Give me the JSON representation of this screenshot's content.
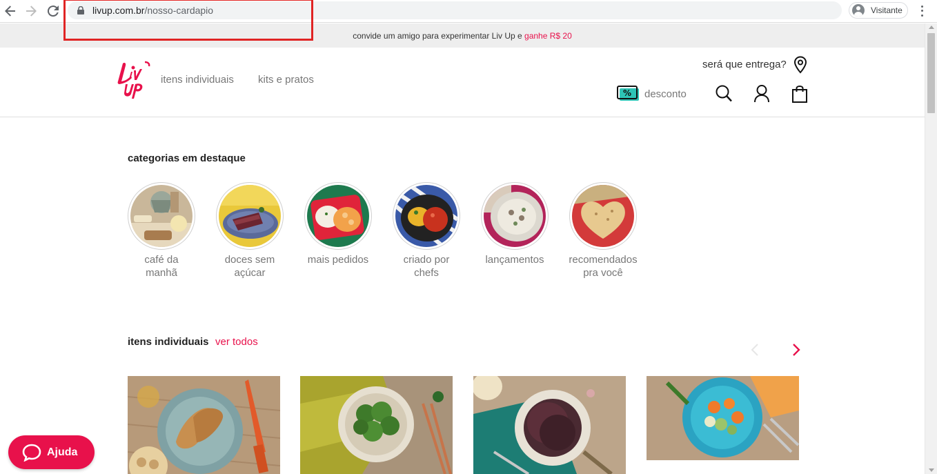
{
  "browser": {
    "url_domain": "livup.com.br",
    "url_path": "/nosso-cardapio",
    "profile_label": "Visitante"
  },
  "promo": {
    "text": "convide um amigo para experimentar Liv Up e ",
    "highlight": "ganhe R$ 20"
  },
  "header": {
    "nav": [
      "itens individuais",
      "kits e pratos"
    ],
    "delivery_question": "será que entrega?",
    "discount_label": "desconto"
  },
  "categories": {
    "title": "categorias em destaque",
    "items": [
      {
        "label": "café da manhã"
      },
      {
        "label": "doces sem açúcar"
      },
      {
        "label": "mais pedidos"
      },
      {
        "label": "criado por chefs"
      },
      {
        "label": "lançamentos"
      },
      {
        "label": "recomendados pra você"
      }
    ]
  },
  "individual_items": {
    "title": "itens individuais",
    "see_all": "ver todos"
  },
  "help": {
    "label": "Ajuda"
  },
  "colors": {
    "brand": "#e8114b",
    "discount_teal": "#2ec4b6"
  }
}
